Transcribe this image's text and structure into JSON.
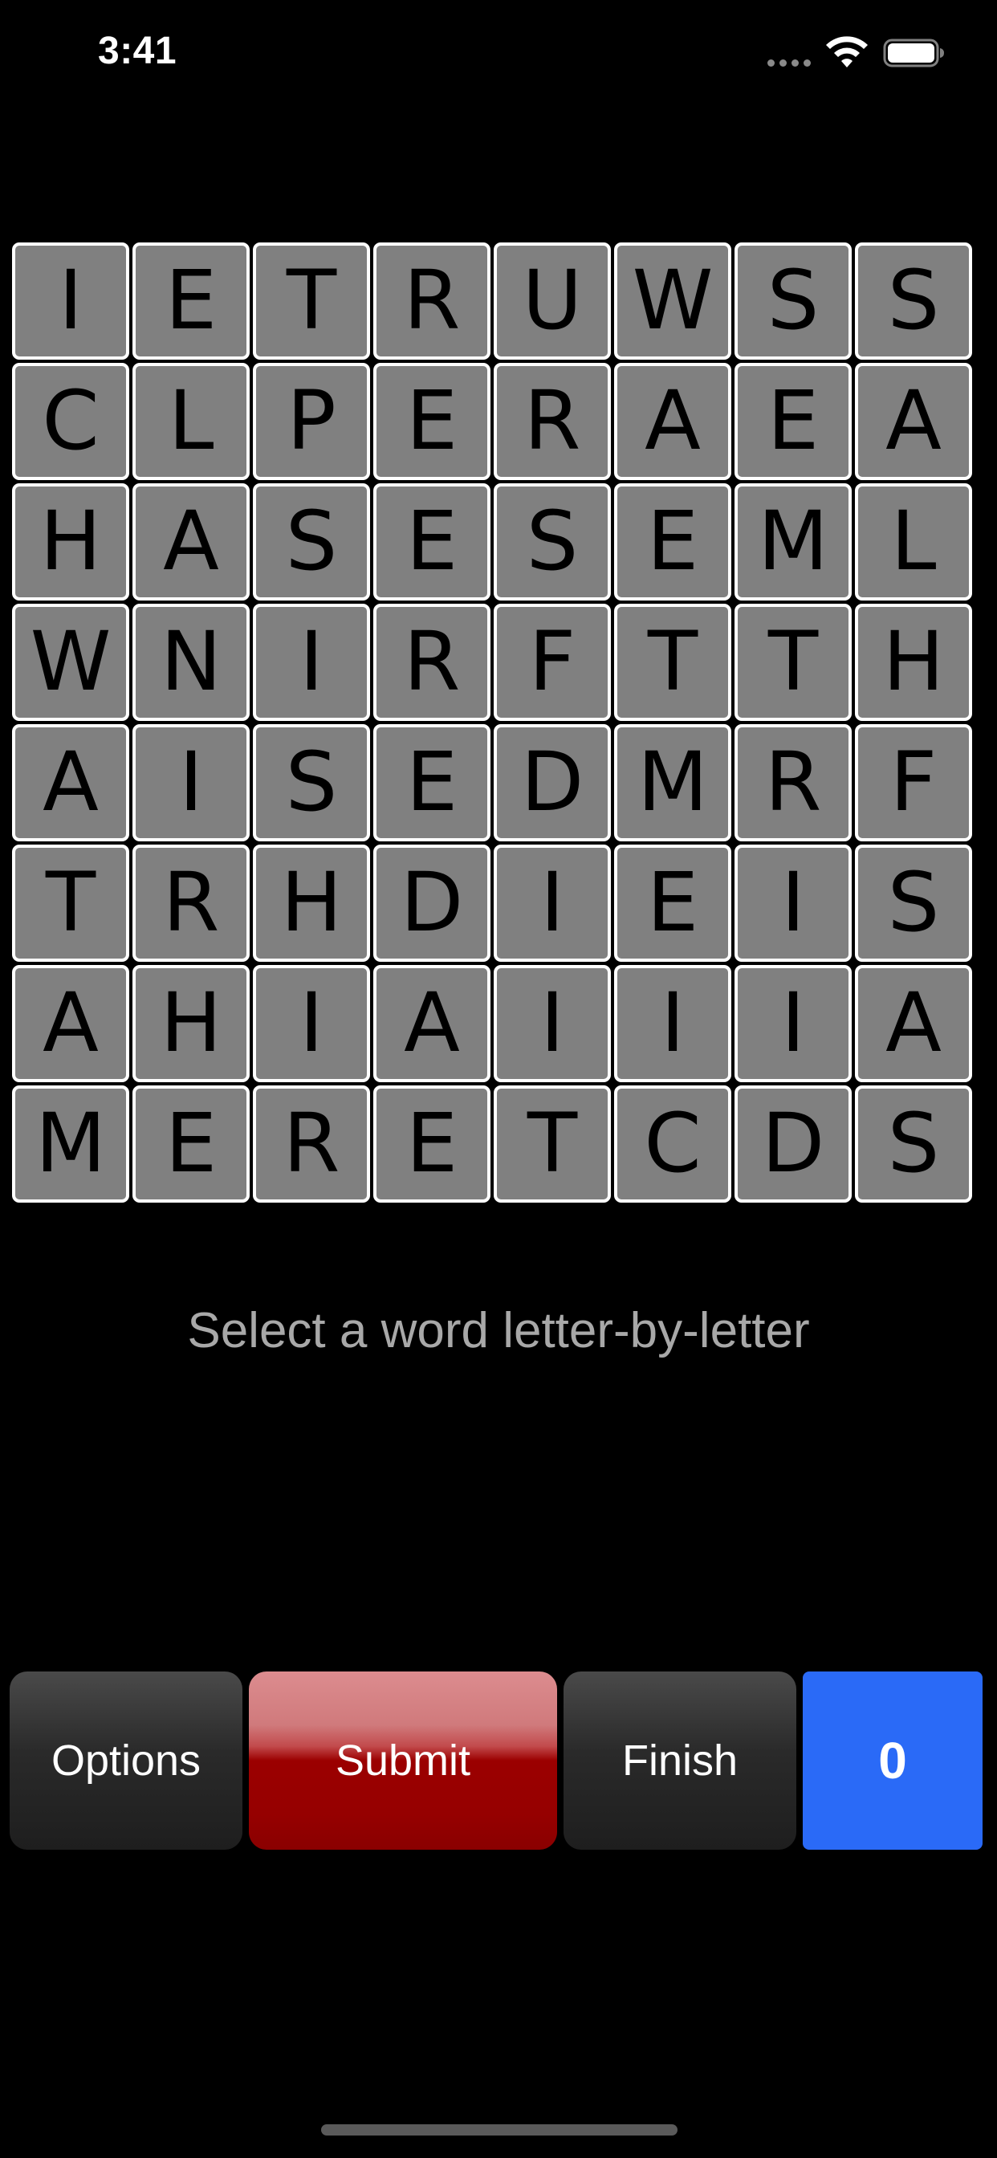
{
  "status_bar": {
    "time": "3:41",
    "signal_icon": "signal-dots-icon",
    "wifi_icon": "wifi-icon",
    "battery_icon": "battery-icon"
  },
  "board": {
    "rows": [
      [
        "I",
        "E",
        "T",
        "R",
        "U",
        "W",
        "S",
        "S"
      ],
      [
        "C",
        "L",
        "P",
        "E",
        "R",
        "A",
        "E",
        "A"
      ],
      [
        "H",
        "A",
        "S",
        "E",
        "S",
        "E",
        "M",
        "L"
      ],
      [
        "W",
        "N",
        "I",
        "R",
        "F",
        "T",
        "T",
        "H"
      ],
      [
        "A",
        "I",
        "S",
        "E",
        "D",
        "M",
        "R",
        "F"
      ],
      [
        "T",
        "R",
        "H",
        "D",
        "I",
        "E",
        "I",
        "S"
      ],
      [
        "A",
        "H",
        "I",
        "A",
        "I",
        "I",
        "I",
        "A"
      ],
      [
        "M",
        "E",
        "R",
        "E",
        "T",
        "C",
        "D",
        "S"
      ]
    ]
  },
  "hint": "Select a word letter-by-letter",
  "buttons": {
    "options": "Options",
    "submit": "Submit",
    "finish": "Finish"
  },
  "score": "0",
  "colors": {
    "background": "#000000",
    "tile": "#808080",
    "tile_border": "#ffffff",
    "submit": "#9b0000",
    "score_box": "#2a6af7",
    "hint_text": "#a8a8a8"
  }
}
